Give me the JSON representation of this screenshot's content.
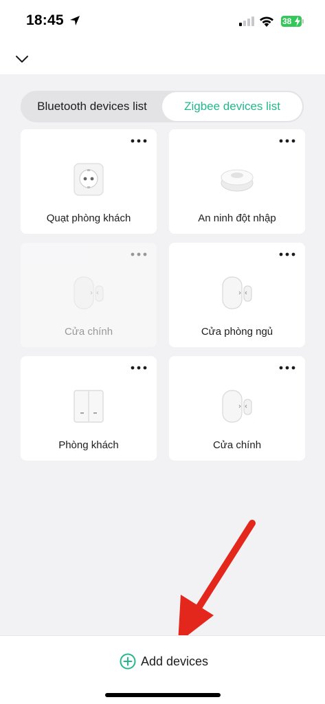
{
  "status_bar": {
    "time": "18:45",
    "battery_level": "38",
    "icons": [
      "location-arrow-icon",
      "cellular-signal-icon",
      "wifi-icon",
      "battery-charging-icon"
    ],
    "battery_color": "#34c759"
  },
  "header": {
    "collapse_icon": "chevron-down-icon"
  },
  "tabs": {
    "bluetooth_label": "Bluetooth devices list",
    "zigbee_label": "Zigbee devices list",
    "active": "zigbee",
    "active_color": "#21b989"
  },
  "devices": [
    {
      "name": "Quạt phòng khách",
      "type": "smart-plug",
      "online": true
    },
    {
      "name": "An ninh đột nhập",
      "type": "motion-sensor",
      "online": true
    },
    {
      "name": "Cửa chính",
      "type": "door-sensor",
      "online": false
    },
    {
      "name": "Cửa phòng ngủ",
      "type": "door-sensor",
      "online": true
    },
    {
      "name": "Phòng khách",
      "type": "wall-switch",
      "online": true
    },
    {
      "name": "Cửa chính",
      "type": "door-sensor",
      "online": true
    }
  ],
  "footer": {
    "add_label": "Add devices",
    "add_icon": "plus-circle-icon",
    "accent": "#21b989"
  },
  "annotation": {
    "arrow_color": "#e3271c"
  }
}
